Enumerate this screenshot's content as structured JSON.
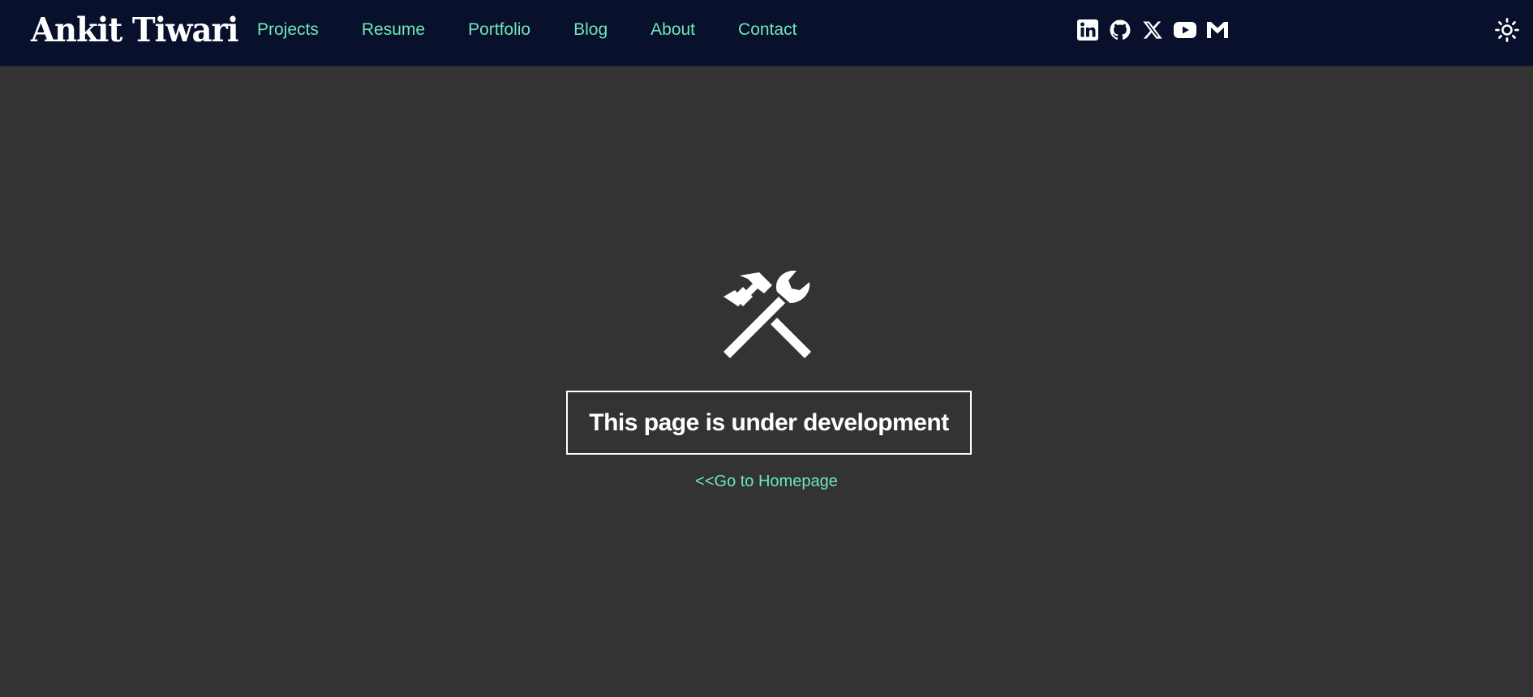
{
  "header": {
    "brand": "Ankit Tiwari",
    "nav": [
      {
        "label": "Projects"
      },
      {
        "label": "Resume"
      },
      {
        "label": "Portfolio"
      },
      {
        "label": "Blog"
      },
      {
        "label": "About"
      },
      {
        "label": "Contact"
      }
    ],
    "socials": [
      "linkedin-icon",
      "github-icon",
      "x-twitter-icon",
      "youtube-icon",
      "medium-icon"
    ],
    "theme_toggle_icon": "sun-icon"
  },
  "main": {
    "icon": "tools-icon",
    "message": "This page is under development",
    "home_link": "<<Go to Homepage"
  },
  "colors": {
    "navbar_bg": "#08102c",
    "page_bg": "#333333",
    "accent": "#6ee7b7",
    "text": "#ffffff"
  }
}
